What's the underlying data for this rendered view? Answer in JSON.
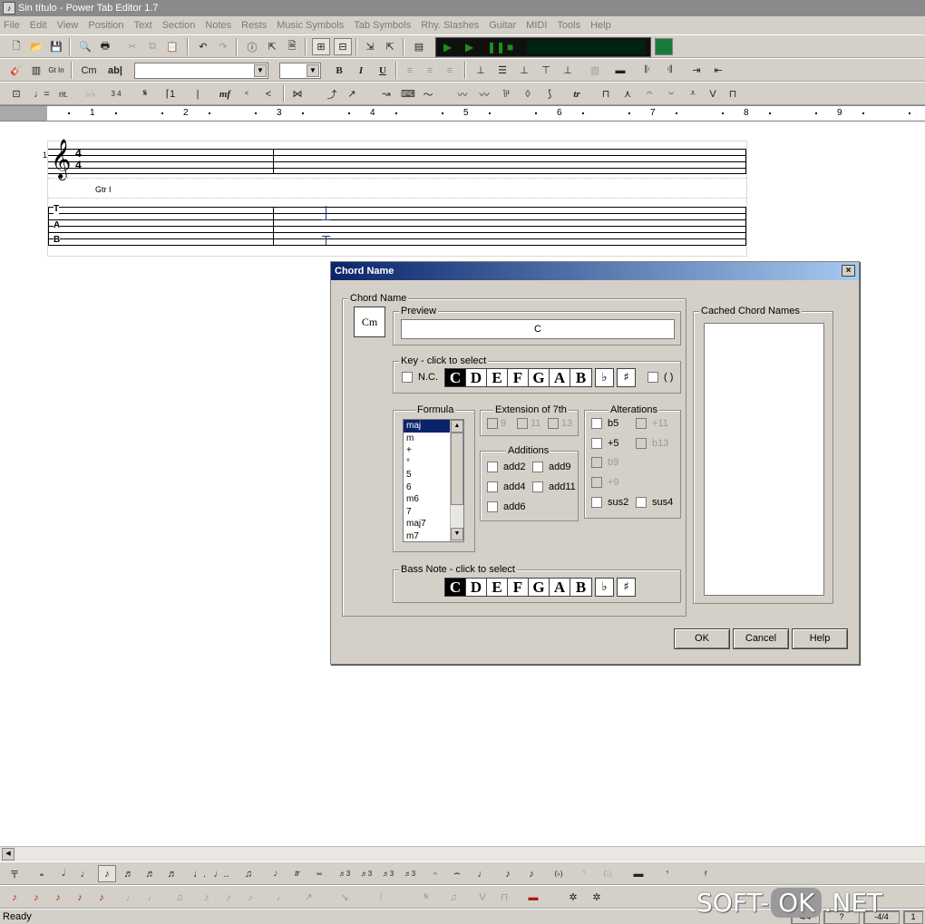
{
  "window": {
    "title": "Sin título - Power Tab Editor 1.7"
  },
  "menu": [
    "File",
    "Edit",
    "View",
    "Position",
    "Text",
    "Section",
    "Notes",
    "Rests",
    "Music Symbols",
    "Tab Symbols",
    "Rhy. Slashes",
    "Guitar",
    "MIDI",
    "Tools",
    "Help"
  ],
  "toolbar2": {
    "chord_label": "Cm",
    "text_label": "ab|",
    "bold": "B",
    "italic": "I",
    "underline": "U"
  },
  "toolbar3": {
    "dynamic": "mf",
    "tr": "tr"
  },
  "ruler": {
    "numbers": [
      "1",
      "2",
      "3",
      "4",
      "5",
      "6",
      "7",
      "8",
      "9"
    ]
  },
  "score": {
    "system_number": "1",
    "time_sig_top": "4",
    "time_sig_bottom": "4",
    "tab_t": "T",
    "tab_a": "A",
    "tab_b": "B",
    "chord_above": "Gtr I"
  },
  "dialog": {
    "title": "Chord Name",
    "close": "×",
    "chord_name_group": "Chord Name",
    "chord_icon": "Cm",
    "preview_label": "Preview",
    "preview_value": "C",
    "key_label": "Key - click to select",
    "nc_label": "N.C.",
    "notes": [
      "C",
      "D",
      "E",
      "F",
      "G",
      "A",
      "B"
    ],
    "selected_note": "C",
    "flat": "♭",
    "sharp": "♯",
    "paren_label": "( )",
    "formula_label": "Formula",
    "formula_items": [
      "maj",
      "m",
      "+",
      "°",
      "5",
      "6",
      "m6",
      "7",
      "maj7",
      "m7"
    ],
    "formula_selected": "maj",
    "extension_label": "Extension of 7th",
    "extensions": [
      "9",
      "11",
      "13"
    ],
    "additions_label": "Additions",
    "additions": [
      "add2",
      "add9",
      "add4",
      "add11",
      "add6"
    ],
    "alterations_label": "Alterations",
    "alterations": [
      "b5",
      "+11",
      "+5",
      "b13",
      "b9",
      "+9",
      "sus2",
      "sus4"
    ],
    "bass_label": "Bass Note - click to select",
    "cached_label": "Cached Chord Names",
    "ok": "OK",
    "cancel": "Cancel",
    "help": "Help"
  },
  "status": {
    "text": "Ready",
    "panel1": "4/4",
    "panel2": "?",
    "panel3": "-4/4",
    "panel4": "1"
  },
  "watermark": {
    "left": "SOFT-",
    "pill": "OK",
    "right": ".NET"
  }
}
